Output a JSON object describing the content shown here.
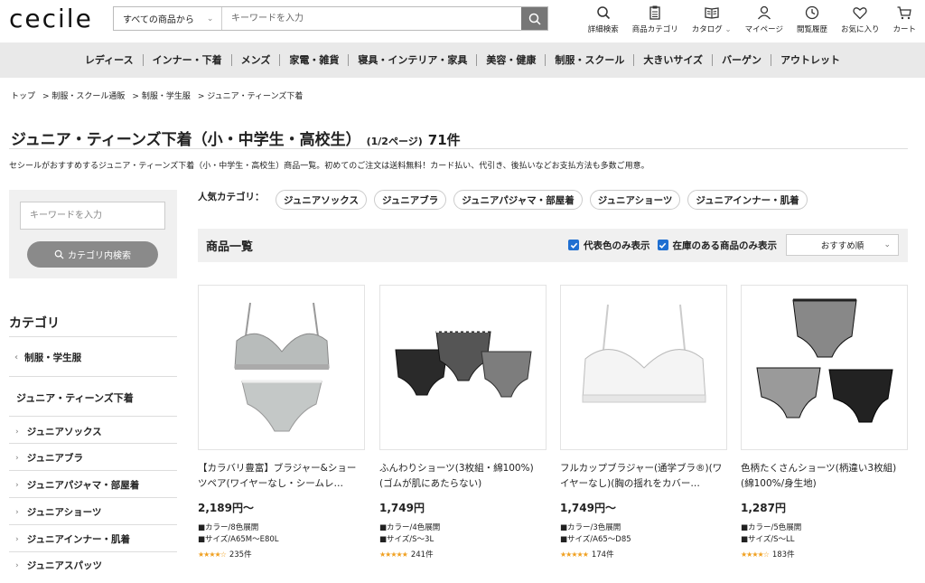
{
  "header": {
    "logo": "cecile",
    "search_category": "すべての商品から",
    "search_placeholder": "キーワードを入力",
    "icons": [
      {
        "label": "詳細検索",
        "icon": "search-icon"
      },
      {
        "label": "商品カテゴリ",
        "icon": "clipboard-icon"
      },
      {
        "label": "カタログ",
        "icon": "book-icon"
      },
      {
        "label": "マイページ",
        "icon": "person-icon"
      },
      {
        "label": "閲覧履歴",
        "icon": "clock-icon"
      },
      {
        "label": "お気に入り",
        "icon": "heart-icon"
      },
      {
        "label": "カート",
        "icon": "cart-icon"
      }
    ]
  },
  "catnav": [
    "レディース",
    "インナー・下着",
    "メンズ",
    "家電・雑貨",
    "寝具・インテリア・家具",
    "美容・健康",
    "制服・スクール",
    "大きいサイズ",
    "バーゲン",
    "アウトレット"
  ],
  "breadcrumb": [
    "トップ",
    "> 制服・スクール通販",
    "> 制服・学生服",
    "> ジュニア・ティーンズ下着"
  ],
  "page": {
    "title": "ジュニア・ティーンズ下着（小・中学生・高校生）",
    "page_info": "(1/2ページ)",
    "count": "71件",
    "description": "セシールがおすすめするジュニア・ティーンズ下着（小・中学生・高校生）商品一覧。初めてのご注文は送料無料！カード払い、代引き、後払いなどお支払方法も多数ご用意。"
  },
  "sidebar": {
    "search_placeholder": "キーワードを入力",
    "search_button": "カテゴリ内検索",
    "category_heading": "カテゴリ",
    "parent": "制服・学生服",
    "current": "ジュニア・ティーンズ下着",
    "items": [
      "ジュニアソックス",
      "ジュニアブラ",
      "ジュニアパジャマ・部屋着",
      "ジュニアショーツ",
      "ジュニアインナー・肌着",
      "ジュニアスパッツ"
    ]
  },
  "popular": {
    "label": "人気カテゴリ：",
    "chips": [
      "ジュニアソックス",
      "ジュニアブラ",
      "ジュニアパジャマ・部屋着",
      "ジュニアショーツ",
      "ジュニアインナー・肌着"
    ]
  },
  "products_bar": {
    "title": "商品一覧",
    "opt1": "代表色のみ表示",
    "opt2": "在庫のある商品のみ表示",
    "sort": "おすすめ順"
  },
  "products": [
    {
      "name": "【カラバリ豊富】ブラジャー&ショーツペア(ワイヤーなし・シームレ…",
      "price": "2,189円〜",
      "color": "■カラー/8色展開",
      "size": "■サイズ/A65M〜E80L",
      "stars": "★★★★☆",
      "reviews": "235件"
    },
    {
      "name": "ふんわりショーツ(3枚組・綿100%)(ゴムが肌にあたらない)",
      "price": "1,749円",
      "color": "■カラー/4色展開",
      "size": "■サイズ/S〜3L",
      "stars": "★★★★★",
      "reviews": "241件"
    },
    {
      "name": "フルカップブラジャー(通学ブラ®)(ワイヤーなし)(胸の揺れをカバー…",
      "price": "1,749円〜",
      "color": "■カラー/3色展開",
      "size": "■サイズ/A65〜D85",
      "stars": "★★★★★",
      "reviews": "174件"
    },
    {
      "name": "色柄たくさんショーツ(柄違い3枚組)(綿100%/身生地)",
      "price": "1,287円",
      "color": "■カラー/5色展開",
      "size": "■サイズ/S〜LL",
      "stars": "★★★★☆",
      "reviews": "183件"
    }
  ]
}
